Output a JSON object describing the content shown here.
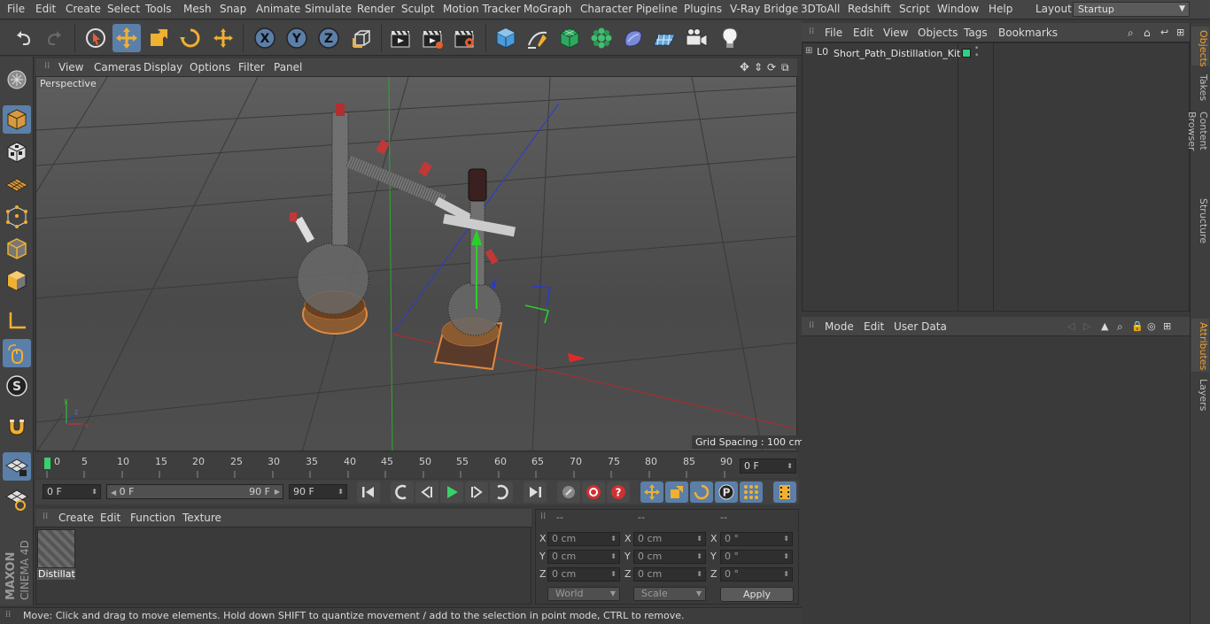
{
  "menubar": {
    "items": [
      "File",
      "Edit",
      "Create",
      "Select",
      "Tools",
      "Mesh",
      "Snap",
      "Animate",
      "Simulate",
      "Render",
      "Sculpt",
      "Motion Tracker",
      "MoGraph",
      "Character",
      "Pipeline",
      "Plugins",
      "V-Ray Bridge",
      "3DToAll",
      "Redshift",
      "Script",
      "Window",
      "Help"
    ],
    "layout_label": "Layout:",
    "layout_value": "Startup"
  },
  "viewport": {
    "menu": [
      "View",
      "Cameras",
      "Display",
      "Options",
      "Filter",
      "Panel"
    ],
    "camera_label": "Perspective",
    "grid_spacing": "Grid Spacing : 100 cm"
  },
  "timeline": {
    "ticks": [
      "0",
      "5",
      "10",
      "15",
      "20",
      "25",
      "30",
      "35",
      "40",
      "45",
      "50",
      "55",
      "60",
      "65",
      "70",
      "75",
      "80",
      "85",
      "90"
    ],
    "current_frame": "0 F"
  },
  "transport": {
    "start_field": "0 F",
    "range_start": "0 F",
    "range_end": "90 F",
    "end_field": "90 F"
  },
  "material_manager": {
    "menu": [
      "Create",
      "Edit",
      "Function",
      "Texture"
    ],
    "material_name": "Distillati"
  },
  "coordinates": {
    "headers": [
      "--",
      "--",
      "--"
    ],
    "rows": [
      {
        "axis": "X",
        "pos": "0 cm",
        "size_axis": "X",
        "size": "0 cm",
        "rot_axis": "X",
        "rot": "0 °"
      },
      {
        "axis": "Y",
        "pos": "0 cm",
        "size_axis": "Y",
        "size": "0 cm",
        "rot_axis": "Y",
        "rot": "0 °"
      },
      {
        "axis": "Z",
        "pos": "0 cm",
        "size_axis": "Z",
        "size": "0 cm",
        "rot_axis": "Z",
        "rot": "0 °"
      }
    ],
    "coord_mode": "World",
    "size_mode": "Scale",
    "apply_label": "Apply"
  },
  "status": {
    "text": "Move: Click and drag to move elements. Hold down SHIFT to quantize movement / add to the selection in point mode, CTRL to remove."
  },
  "object_manager": {
    "menu": [
      "File",
      "Edit",
      "View",
      "Objects",
      "Tags",
      "Bookmarks"
    ],
    "object_name": "Short_Path_Distillation_Kit",
    "tag_color": "#2fd083"
  },
  "attribute_manager": {
    "menu": [
      "Mode",
      "Edit",
      "User Data"
    ]
  },
  "right_tabs": [
    "Objects",
    "Takes",
    "Content Browser",
    "Structure",
    "Attributes",
    "Layers"
  ],
  "logo": {
    "brand": "MAXON",
    "product": "CINEMA 4D"
  },
  "colors": {
    "accent": "#5b7fa8",
    "panel": "#3a3a3a",
    "highlight": "#f0a030"
  }
}
